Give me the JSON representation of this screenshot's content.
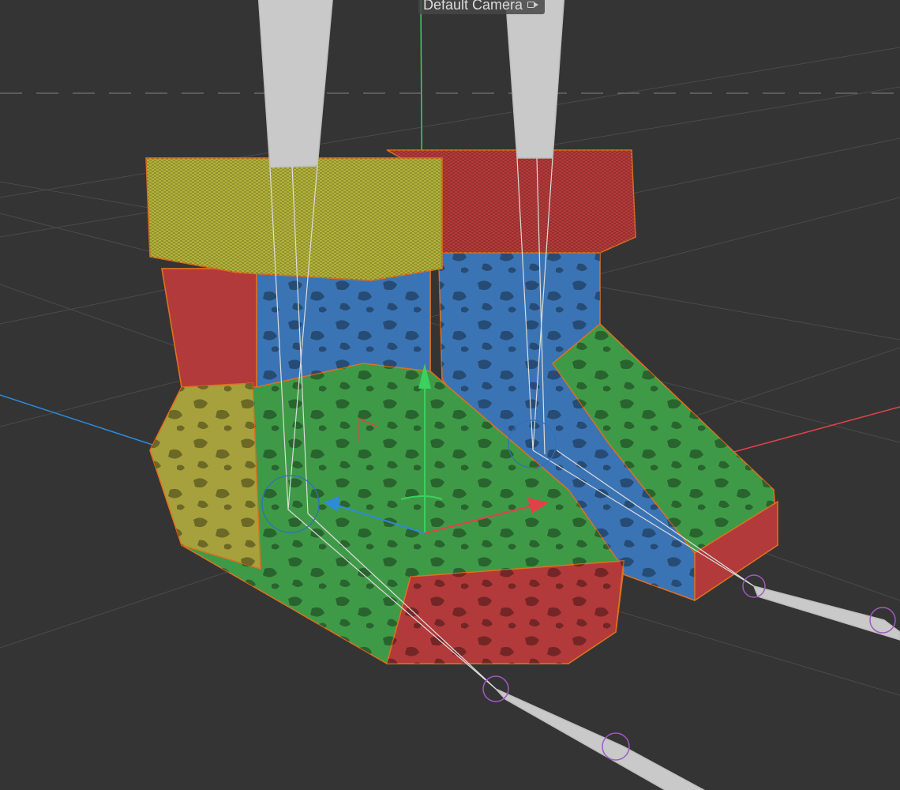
{
  "viewport": {
    "camera_label": "Default Camera",
    "camera_icon": "camera-icon",
    "background_color": "#343434",
    "grid_color": "#4a4a4a",
    "horizon_dashes_color": "#6a6a6a",
    "axis_colors": {
      "x": "#e0424a",
      "y": "#3ad15e",
      "z": "#2f8ad8"
    },
    "selection_outline_color": "#e0701e",
    "material_colors": {
      "cuff_left": "#b2b23a",
      "cuff_right": "#b53a3a",
      "green": "#3f9a47",
      "blue": "#3b74b4",
      "red": "#b23a3a",
      "yellow": "#a6a13c"
    }
  }
}
